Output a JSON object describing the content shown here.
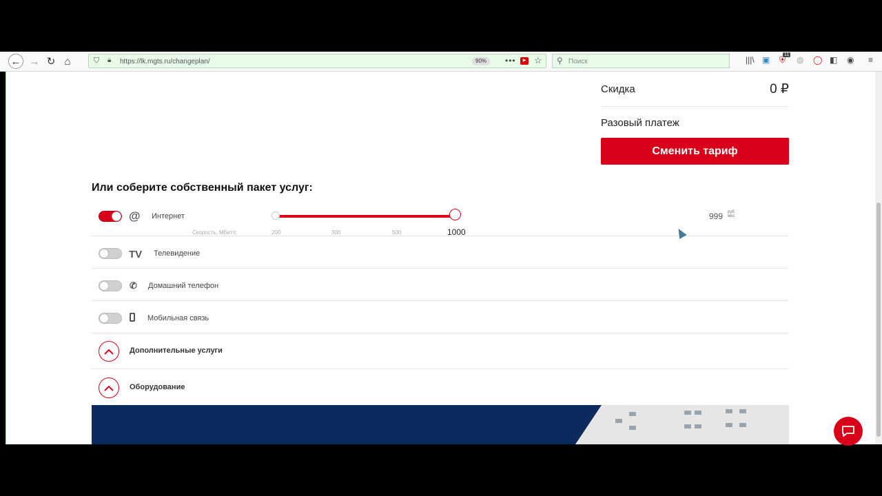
{
  "browser": {
    "url": "https://lk.mgts.ru/changeplan/",
    "zoom": "90%",
    "search_placeholder": "Поиск",
    "badge_count": "11"
  },
  "summary": {
    "discount_label": "Скидка",
    "discount_value": "0 ₽",
    "onetime_label": "Разовый платеж",
    "change_button": "Сменить тариф"
  },
  "builder": {
    "title": "Или соберите собственный пакет услуг:",
    "internet": {
      "label": "Интернет",
      "enabled": true,
      "speed_caption": "Скорость, Мбит/с",
      "ticks": [
        "200",
        "300",
        "500"
      ],
      "selected_value": "1000",
      "slider_fraction": 1.0,
      "price": "999",
      "price_unit": "руб мес"
    },
    "services": [
      {
        "label": "Телевидение",
        "icon": "tv-icon",
        "enabled": false
      },
      {
        "label": "Домашний телефон",
        "icon": "phone-icon",
        "enabled": false
      },
      {
        "label": "Мобильная связь",
        "icon": "mobile-icon",
        "enabled": false
      }
    ],
    "sections": [
      {
        "label": "Дополнительные услуги"
      },
      {
        "label": "Оборудование"
      }
    ]
  },
  "icons": {
    "internet": "at-icon",
    "tv_glyph": "TV",
    "chat": "chat-icon"
  },
  "colors": {
    "brand_red": "#d9001a",
    "banner_blue": "#0d2a5e"
  }
}
